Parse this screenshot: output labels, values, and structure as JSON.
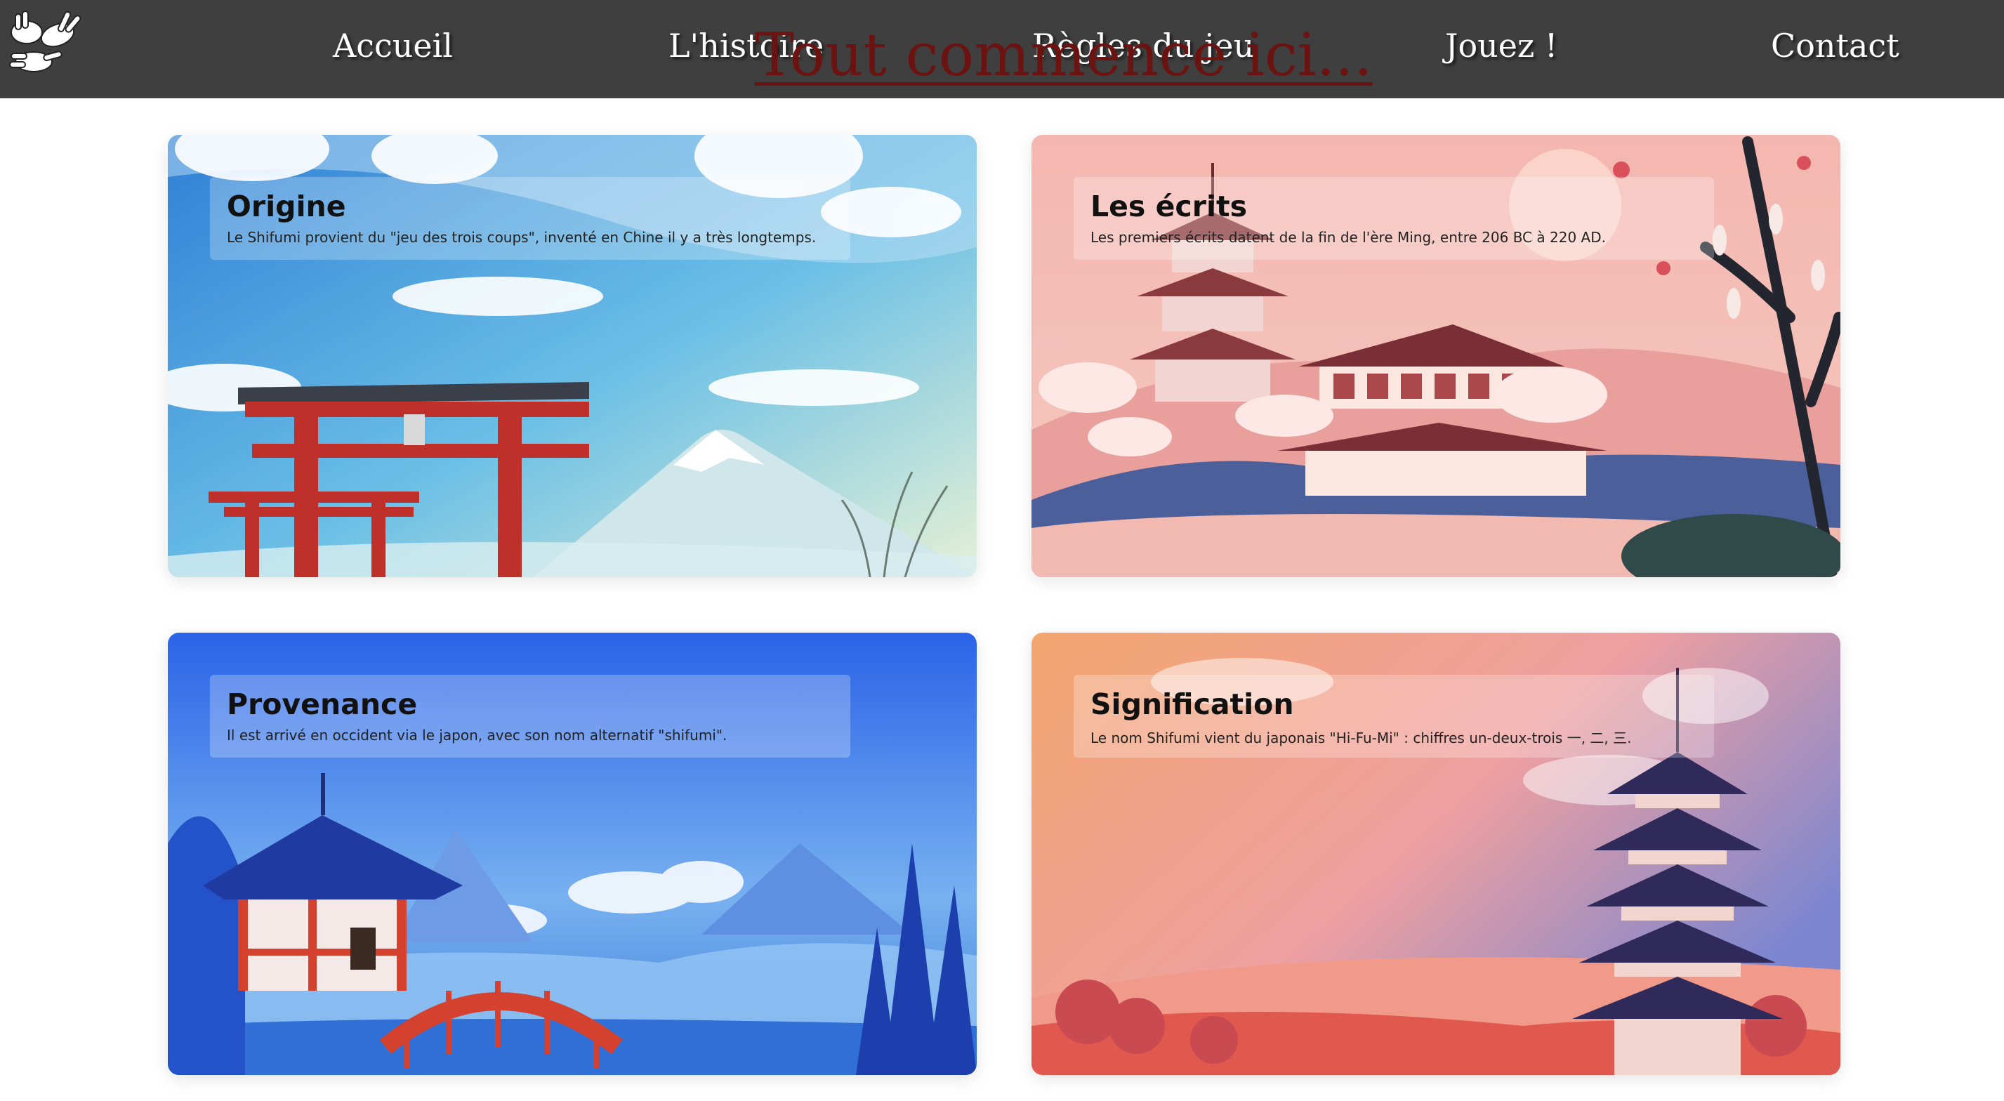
{
  "nav": {
    "logo_icon": "rock-paper-scissors-hands-icon",
    "links": [
      {
        "label": "Accueil"
      },
      {
        "label": "L'histoire"
      },
      {
        "label": "Règles du jeu"
      },
      {
        "label": "Jouez !"
      },
      {
        "label": "Contact"
      }
    ]
  },
  "hero": {
    "title": "Tout commence ici..."
  },
  "cards": [
    {
      "title": "Origine",
      "text": "Le Shifumi provient du \"jeu des trois coups\", inventé en Chine il y a très longtemps.",
      "image": "torii-gate-mount-fuji-illustration"
    },
    {
      "title": "Les écrits",
      "text": "Les premiers écrits datent de la fin de l'ère Ming, entre 206 BC à 220 AD.",
      "image": "pink-pagoda-cherry-blossom-illustration"
    },
    {
      "title": "Provenance",
      "text": "Il est arrivé en occident via le japon, avec son nom alternatif \"shifumi\".",
      "image": "blue-pavilion-red-bridge-illustration"
    },
    {
      "title": "Signification",
      "text": "Le nom Shifumi vient du japonais \"Hi-Fu-Mi\" : chiffres un-deux-trois 一, 二, 三.",
      "image": "sunset-pagoda-illustration"
    }
  ],
  "colors": {
    "nav_background": "#3f3f3f",
    "hero_title": "#6b1310",
    "page_background": "#ffffff"
  }
}
